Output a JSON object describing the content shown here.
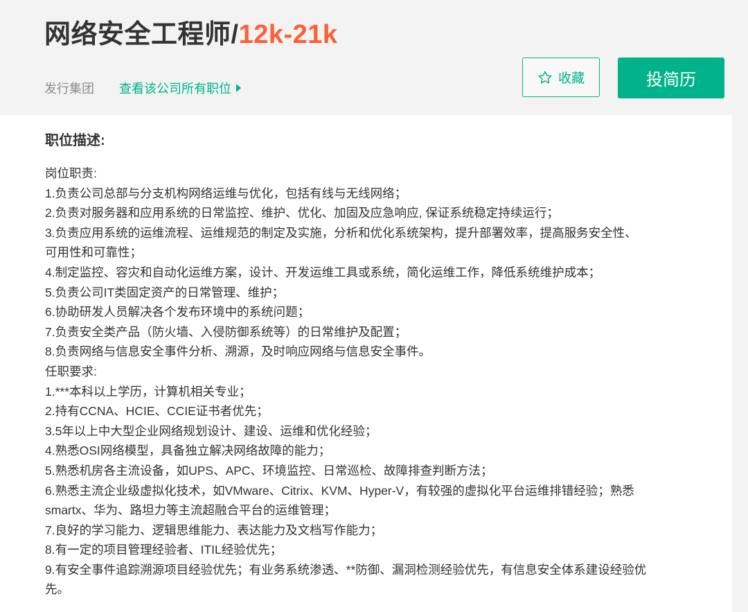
{
  "job": {
    "title": "网络安全工程师/",
    "salary": "12k-21k",
    "company": "发行集团",
    "all_jobs_link": "查看该公司所有职位"
  },
  "actions": {
    "favorite_label": "收藏",
    "apply_label": "投简历"
  },
  "description": {
    "heading": "职位描述:",
    "lines": [
      "岗位职责:",
      "1.负责公司总部与分支机构网络运维与优化，包括有线与无线网络；",
      "2.负责对服务器和应用系统的日常监控、维护、优化、加固及应急响应, 保证系统稳定持续运行；",
      "3.负责应用系统的运维流程、运维规范的制定及实施，分析和优化系统架构，提升部署效率，提高服务安全性、",
      "可用性和可靠性；",
      "4.制定监控、容灾和自动化运维方案，设计、开发运维工具或系统，简化运维工作，降低系统维护成本；",
      "5.负责公司IT类固定资产的日常管理、维护；",
      "6.协助研发人员解决各个发布环境中的系统问题；",
      "7.负责安全类产品（防火墙、入侵防御系统等）的日常维护及配置；",
      "8.负责网络与信息安全事件分析、溯源，及时响应网络与信息安全事件。",
      "任职要求:",
      "1.***本科以上学历，计算机相关专业；",
      "2.持有CCNA、HCIE、CCIE证书者优先；",
      "3.5年以上中大型企业网络规划设计、建设、运维和优化经验；",
      "4.熟悉OSI网络模型，具备独立解决网络故障的能力；",
      "5.熟悉机房各主流设备，如UPS、APC、环境监控、日常巡检、故障排查判断方法；",
      "6.熟悉主流企业级虚拟化技术，如VMware、Citrix、KVM、Hyper-V，有较强的虚拟化平台运维排错经验；熟悉",
      "smartx、华为、路坦力等主流超融合平台的运维管理；",
      "7.良好的学习能力、逻辑思维能力、表达能力及文档写作能力；",
      "8.有一定的项目管理经验者、ITIL经验优先；",
      "9.有安全事件追踪溯源项目经验优先；有业务系统渗透、**防御、漏洞检测经验优先，有信息安全体系建设经验优",
      "先。"
    ]
  },
  "colors": {
    "accent": "#00b38a",
    "salary": "#fd5f39",
    "text": "#333333",
    "muted": "#8c8c8c"
  },
  "icons": {
    "favorite": "star-outline-icon",
    "link_arrow": "caret-right-icon"
  }
}
